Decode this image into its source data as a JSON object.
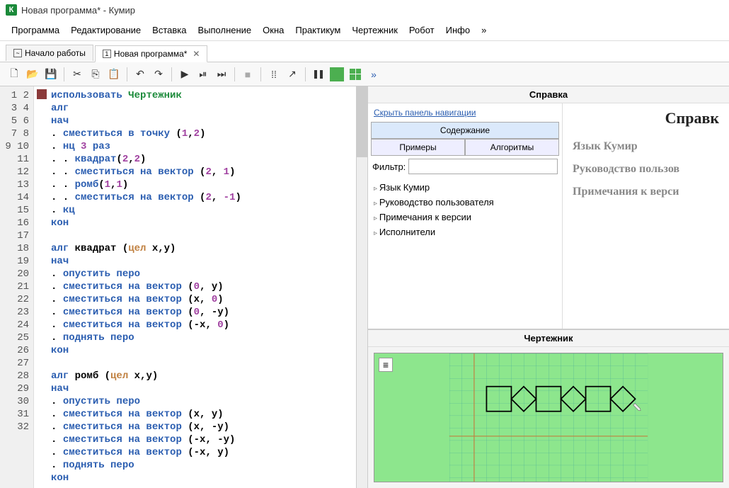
{
  "window": {
    "title": "Новая программа* - Кумир",
    "icon_letter": "К"
  },
  "menu": [
    "Программа",
    "Редактирование",
    "Вставка",
    "Выполнение",
    "Окна",
    "Практикум",
    "Чертежник",
    "Робот",
    "Инфо",
    "»"
  ],
  "tabs": [
    {
      "label": "Начало работы",
      "active": false
    },
    {
      "label": "Новая программа*",
      "active": true,
      "closable": true
    }
  ],
  "code_lines": 32,
  "help": {
    "panel_title": "Справка",
    "hide_nav": "Скрыть панель навигации",
    "tab_contents": "Содержание",
    "tab_examples": "Примеры",
    "tab_algorithms": "Алгоритмы",
    "filter_label": "Фильтр:",
    "tree": [
      "Язык Кумир",
      "Руководство пользователя",
      "Примечания к версии",
      "Исполнители"
    ],
    "content_title": "Справк",
    "links": [
      "Язык Кумир",
      "Руководство пользов",
      "Примечания к верси"
    ]
  },
  "drawing": {
    "title": "Чертежник"
  },
  "code": {
    "l1a": "использовать",
    "l1b": "Чертежник",
    "l2": "алг",
    "l3": "нач",
    "l4a": ". ",
    "l4b": "сместиться в точку",
    "l4c": " (",
    "l4d": "1",
    "l4e": ",",
    "l4f": "2",
    "l4g": ")",
    "l5a": ". ",
    "l5b": "нц",
    "l5c": " 3 ",
    "l5d": "раз",
    "l6a": ". . ",
    "l6b": "квадрат",
    "l6c": "(",
    "l6d": "2",
    "l6e": ",",
    "l6f": "2",
    "l6g": ")",
    "l7a": ". . ",
    "l7b": "сместиться на вектор",
    "l7c": " (",
    "l7d": "2",
    "l7e": ", ",
    "l7f": "1",
    "l7g": ")",
    "l8a": ". . ",
    "l8b": "ромб",
    "l8c": "(",
    "l8d": "1",
    "l8e": ",",
    "l8f": "1",
    "l8g": ")",
    "l9a": ". . ",
    "l9b": "сместиться на вектор",
    "l9c": " (",
    "l9d": "2",
    "l9e": ", ",
    "l9f": "-1",
    "l9g": ")",
    "l10a": ". ",
    "l10b": "кц",
    "l11": "кон",
    "l13a": "алг",
    "l13b": " квадрат (",
    "l13c": "цел",
    "l13d": " x,y)",
    "l14": "нач",
    "l15a": ". ",
    "l15b": "опустить перо",
    "l16a": ". ",
    "l16b": "сместиться на вектор",
    "l16c": " (",
    "l16d": "0",
    "l16e": ", y)",
    "l17a": ". ",
    "l17b": "сместиться на вектор",
    "l17c": " (x, ",
    "l17d": "0",
    "l17e": ")",
    "l18a": ". ",
    "l18b": "сместиться на вектор",
    "l18c": " (",
    "l18d": "0",
    "l18e": ", -y)",
    "l19a": ". ",
    "l19b": "сместиться на вектор",
    "l19c": " (-x, ",
    "l19d": "0",
    "l19e": ")",
    "l20a": ". ",
    "l20b": "поднять перо",
    "l21": "кон",
    "l23a": "алг",
    "l23b": " ромб (",
    "l23c": "цел",
    "l23d": " x,y)",
    "l24": "нач",
    "l25a": ". ",
    "l25b": "опустить перо",
    "l26a": ". ",
    "l26b": "сместиться на вектор",
    "l26c": " (x, y)",
    "l27a": ". ",
    "l27b": "сместиться на вектор",
    "l27c": " (x, -y)",
    "l28a": ". ",
    "l28b": "сместиться на вектор",
    "l28c": " (-x, -y)",
    "l29a": ". ",
    "l29b": "сместиться на вектор",
    "l29c": " (-x, y)",
    "l30a": ". ",
    "l30b": "поднять перо",
    "l31": "кон"
  }
}
